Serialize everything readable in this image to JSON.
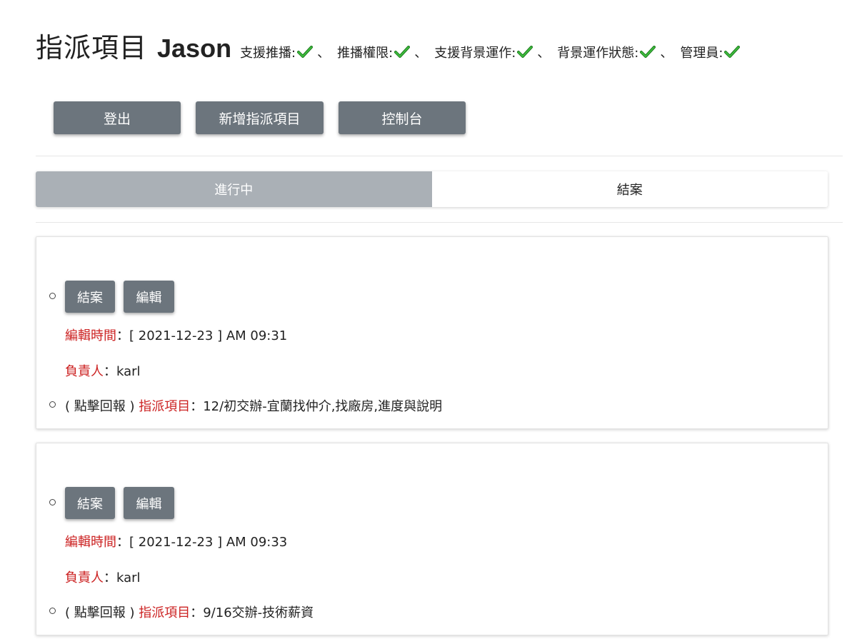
{
  "header": {
    "title": "指派項目",
    "user": "Jason",
    "capabilities": [
      {
        "label": "支援推播:",
        "enabled": true
      },
      {
        "label": "推播權限:",
        "enabled": true
      },
      {
        "label": "支援背景運作:",
        "enabled": true
      },
      {
        "label": "背景運作狀態:",
        "enabled": true
      },
      {
        "label": "管理員:",
        "enabled": true
      }
    ],
    "separator": "、"
  },
  "toolbar": {
    "logout_label": "登出",
    "add_label": "新增指派項目",
    "console_label": "控制台"
  },
  "tabs": [
    {
      "label": "進行中",
      "active": true
    },
    {
      "label": "結案",
      "active": false
    }
  ],
  "cards": [
    {
      "close_label": "結案",
      "edit_label": "編輯",
      "edit_time_label": "編輯時間",
      "edit_time_value": "：[ 2021-12-23 ] AM 09:31",
      "owner_label": "負責人",
      "owner_value": "：karl",
      "report_prefix": "( 點擊回報 )",
      "item_label": "指派項目",
      "item_value": "：12/初交辦-宜蘭找仲介,找廠房,進度與說明"
    },
    {
      "close_label": "結案",
      "edit_label": "編輯",
      "edit_time_label": "編輯時間",
      "edit_time_value": "：[ 2021-12-23 ] AM 09:33",
      "owner_label": "負責人",
      "owner_value": "：karl",
      "report_prefix": "( 點擊回報 )",
      "item_label": "指派項目",
      "item_value": "：9/16交辦-技術薪資"
    }
  ],
  "colors": {
    "button": "#6c757d",
    "active_tab": "#aab0b6",
    "label_red": "#cc2222",
    "check_green": "#2e9b2e"
  }
}
